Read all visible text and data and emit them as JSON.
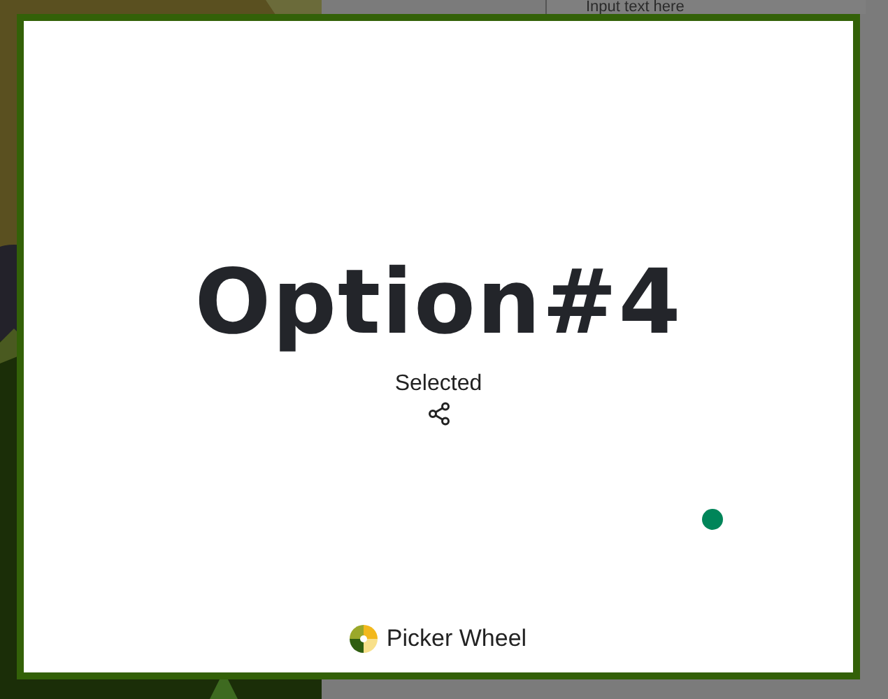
{
  "backdrop": {
    "input": {
      "placeholder": "Input text here"
    }
  },
  "result": {
    "title": "Option#4",
    "label": "Selected"
  },
  "footer": {
    "brand": "Picker Wheel"
  }
}
